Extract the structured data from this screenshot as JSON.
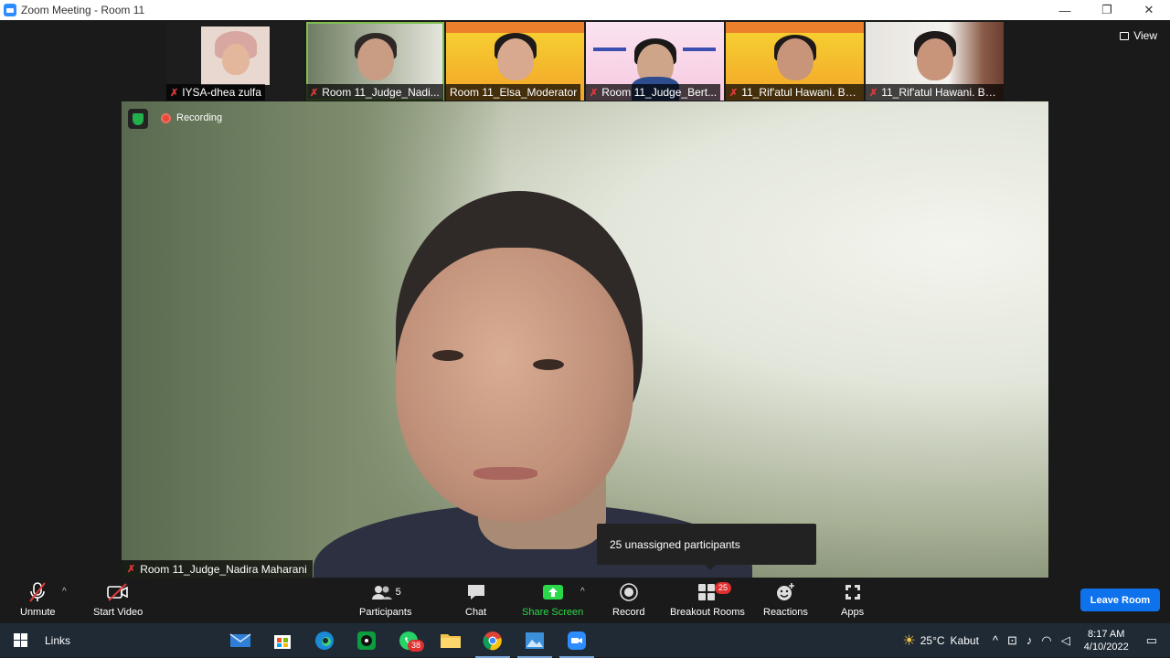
{
  "window": {
    "title": "Zoom Meeting - Room 11",
    "controls": [
      "—",
      "❐",
      "✕"
    ]
  },
  "view_label": "View",
  "thumbnails": [
    {
      "name": "IYSA-dhea zulfa",
      "muted": true,
      "style": "hijab"
    },
    {
      "name": "Room 11_Judge_Nadi...",
      "muted": true,
      "style": "plain",
      "active": true
    },
    {
      "name": "Room 11_Elsa_Moderator",
      "muted": false,
      "style": "banner"
    },
    {
      "name": "Room 11_Judge_Bert...",
      "muted": true,
      "style": "banner-light"
    },
    {
      "name": "11_Rif'atul Hawani. B_...",
      "muted": true,
      "style": "banner"
    },
    {
      "name": "11_Rif'atul Hawani. B_...",
      "muted": true,
      "style": "room"
    }
  ],
  "recording_label": "Recording",
  "speaker_name": "Room 11_Judge_Nadira Maharani",
  "tooltip": "25 unassigned participants",
  "toolbar": {
    "unmute": "Unmute",
    "start_video": "Start Video",
    "participants": "Participants",
    "participants_count": "5",
    "chat": "Chat",
    "share_screen": "Share Screen",
    "record": "Record",
    "breakout_rooms": "Breakout Rooms",
    "breakout_count": "25",
    "reactions": "Reactions",
    "apps": "Apps",
    "leave": "Leave Room"
  },
  "taskbar": {
    "links": "Links",
    "whatsapp_badge": "38",
    "weather_temp": "25°C",
    "weather_desc": "Kabut",
    "time": "8:17 AM",
    "date": "4/10/2022"
  },
  "colors": {
    "accent": "#0e72ed",
    "share": "#2ad94a",
    "muted": "#e03a3a",
    "active_border": "#7fbf4e"
  }
}
